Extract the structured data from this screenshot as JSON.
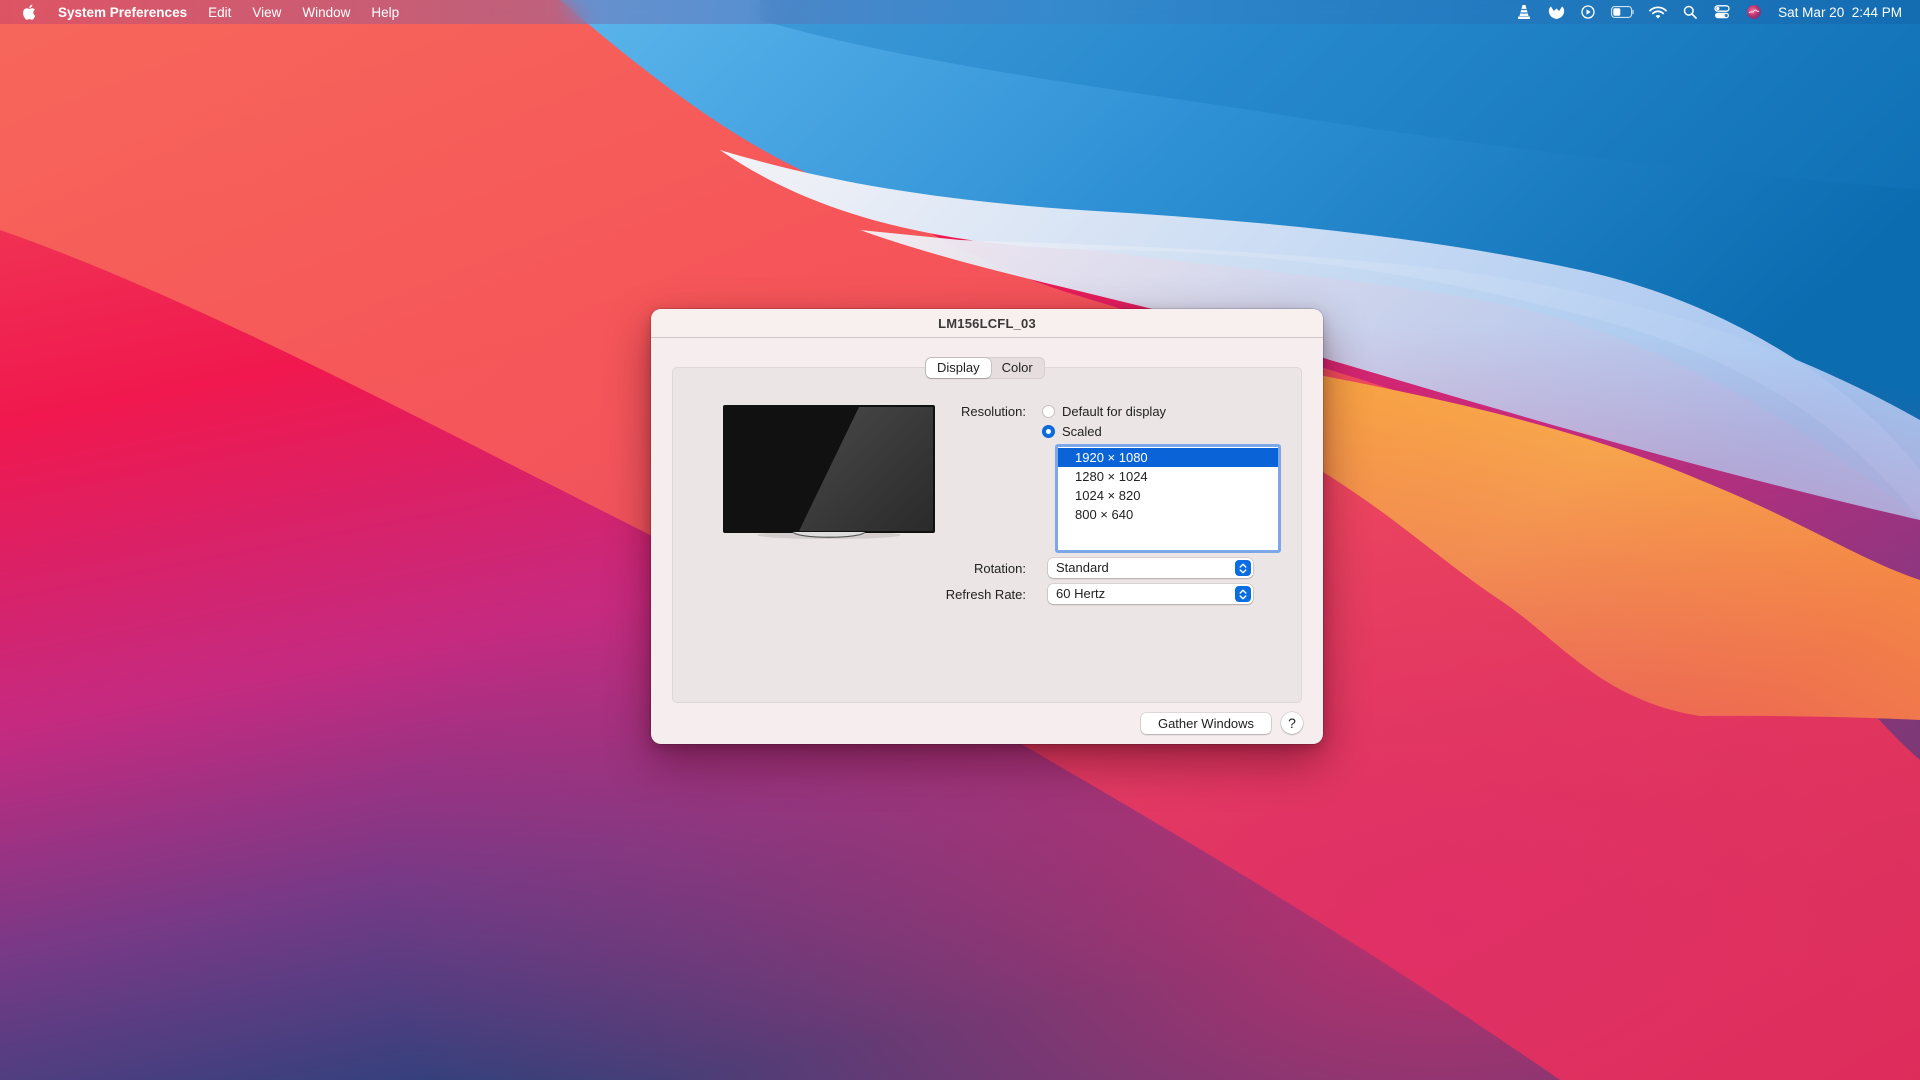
{
  "menubar": {
    "apple_icon": "apple-logo-icon",
    "app_name": "System Preferences",
    "menus": [
      "Edit",
      "View",
      "Window",
      "Help"
    ],
    "status_icons": [
      "vlc-cone-icon",
      "malwarebytes-icon",
      "play-circle-icon",
      "battery-icon",
      "wifi-icon",
      "spotlight-search-icon",
      "control-center-icon",
      "siri-icon"
    ],
    "date": "Sat Mar 20",
    "time": "2:44 PM"
  },
  "window": {
    "title": "LM156LCFL_03",
    "tabs": [
      {
        "label": "Display",
        "active": true
      },
      {
        "label": "Color",
        "active": false
      }
    ],
    "resolution": {
      "label": "Resolution:",
      "options": [
        {
          "label": "Default for display",
          "selected": false
        },
        {
          "label": "Scaled",
          "selected": true
        }
      ],
      "scaled_list": [
        "1920 × 1080",
        "1280 × 1024",
        "1024 × 820",
        "800 × 640"
      ],
      "selected_index": 0
    },
    "rotation": {
      "label": "Rotation:",
      "value": "Standard"
    },
    "refresh_rate": {
      "label": "Refresh Rate:",
      "value": "60 Hertz"
    },
    "gather_windows_label": "Gather Windows",
    "help_label": "?"
  },
  "colors": {
    "accent": "#0a6de0",
    "selection": "#0a64d8",
    "window_bg": "#f6eeee",
    "panel_bg": "#ece5e5"
  }
}
